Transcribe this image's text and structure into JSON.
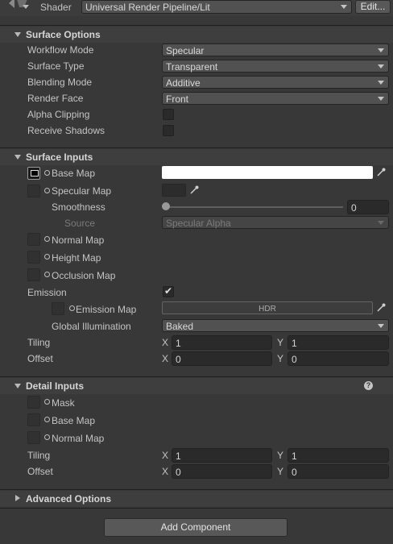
{
  "shader": {
    "label": "Shader",
    "value": "Universal Render Pipeline/Lit",
    "edit_label": "Edit..."
  },
  "surface_options": {
    "title": "Surface Options",
    "workflow_mode": {
      "label": "Workflow Mode",
      "value": "Specular"
    },
    "surface_type": {
      "label": "Surface Type",
      "value": "Transparent"
    },
    "blending_mode": {
      "label": "Blending Mode",
      "value": "Additive"
    },
    "render_face": {
      "label": "Render Face",
      "value": "Front"
    },
    "alpha_clipping": {
      "label": "Alpha Clipping",
      "checked": false
    },
    "receive_shadows": {
      "label": "Receive Shadows",
      "checked": false
    }
  },
  "surface_inputs": {
    "title": "Surface Inputs",
    "base_map": "Base Map",
    "specular_map": "Specular Map",
    "smoothness": {
      "label": "Smoothness",
      "value": "0",
      "slider_fraction": 0
    },
    "source": {
      "label": "Source",
      "value": "Specular Alpha"
    },
    "normal_map": "Normal Map",
    "height_map": "Height Map",
    "occlusion_map": "Occlusion Map",
    "emission": {
      "label": "Emission",
      "checked": true
    },
    "emission_map": {
      "label": "Emission Map",
      "hdr_label": "HDR"
    },
    "global_illumination": {
      "label": "Global Illumination",
      "value": "Baked"
    },
    "tiling": {
      "label": "Tiling",
      "x_label": "X",
      "x": "1",
      "y_label": "Y",
      "y": "1"
    },
    "offset": {
      "label": "Offset",
      "x_label": "X",
      "x": "0",
      "y_label": "Y",
      "y": "0"
    }
  },
  "detail_inputs": {
    "title": "Detail Inputs",
    "mask": "Mask",
    "base_map": "Base Map",
    "normal_map": "Normal Map",
    "tiling": {
      "label": "Tiling",
      "x_label": "X",
      "x": "1",
      "y_label": "Y",
      "y": "1"
    },
    "offset": {
      "label": "Offset",
      "x_label": "X",
      "x": "0",
      "y_label": "Y",
      "y": "0"
    }
  },
  "advanced_options": {
    "title": "Advanced Options"
  },
  "add_component": {
    "label": "Add Component"
  },
  "colors": {
    "panel_bg": "#383838",
    "field_bg": "#2a2a2a",
    "dropdown_bg": "#515151",
    "base_color_swatch": "#ffffff"
  }
}
